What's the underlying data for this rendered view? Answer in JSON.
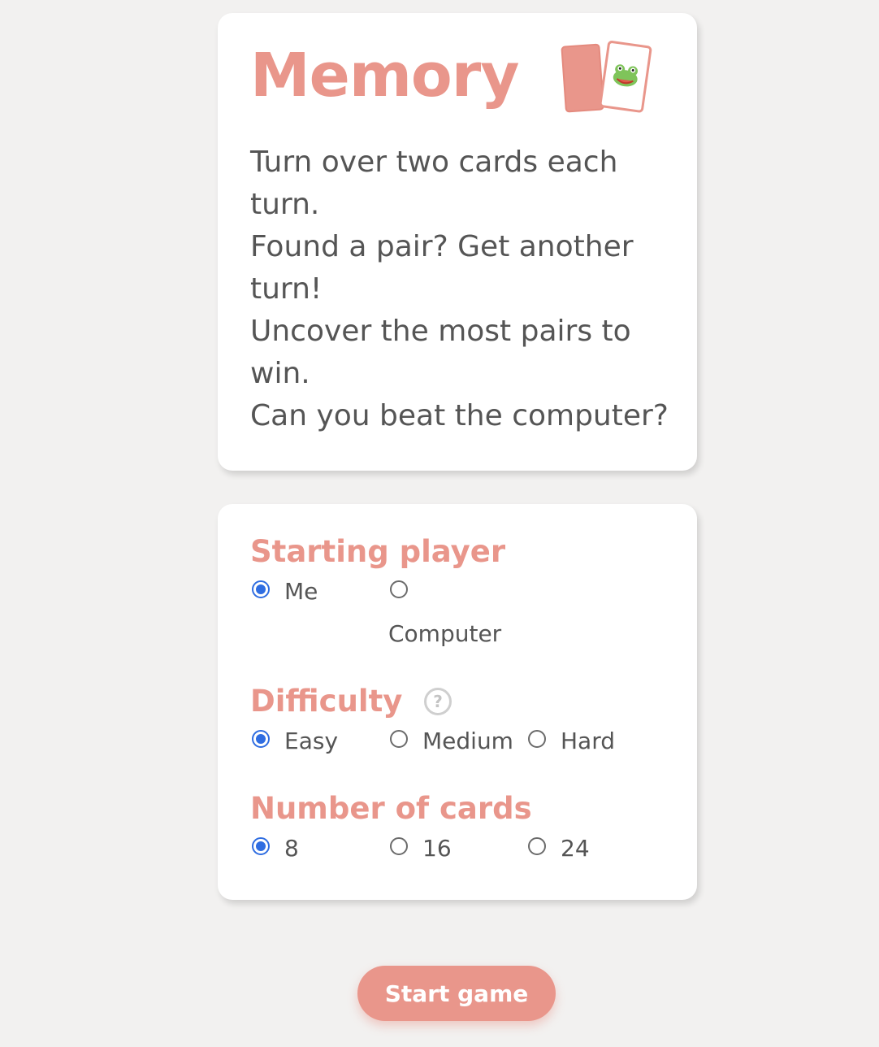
{
  "intro": {
    "title": "Memory",
    "logo_icon": "cards-with-frog-icon",
    "instructions": [
      "Turn over two cards each turn.",
      "Found a pair? Get another turn!",
      "Uncover the most pairs to win.",
      "Can you beat the computer?"
    ]
  },
  "settings": {
    "starting_player": {
      "title": "Starting player",
      "options": [
        "Me",
        "Computer"
      ],
      "selected": "Me"
    },
    "difficulty": {
      "title": "Difficulty",
      "help_symbol": "?",
      "options": [
        "Easy",
        "Medium",
        "Hard"
      ],
      "selected": "Easy"
    },
    "number_of_cards": {
      "title": "Number of cards",
      "options": [
        "8",
        "16",
        "24"
      ],
      "selected": "8"
    }
  },
  "start_button": {
    "label": "Start game"
  },
  "colors": {
    "accent": "#e9968b",
    "radio_checked": "#2f6de1",
    "background": "#f2f1f0",
    "text": "#555555"
  }
}
